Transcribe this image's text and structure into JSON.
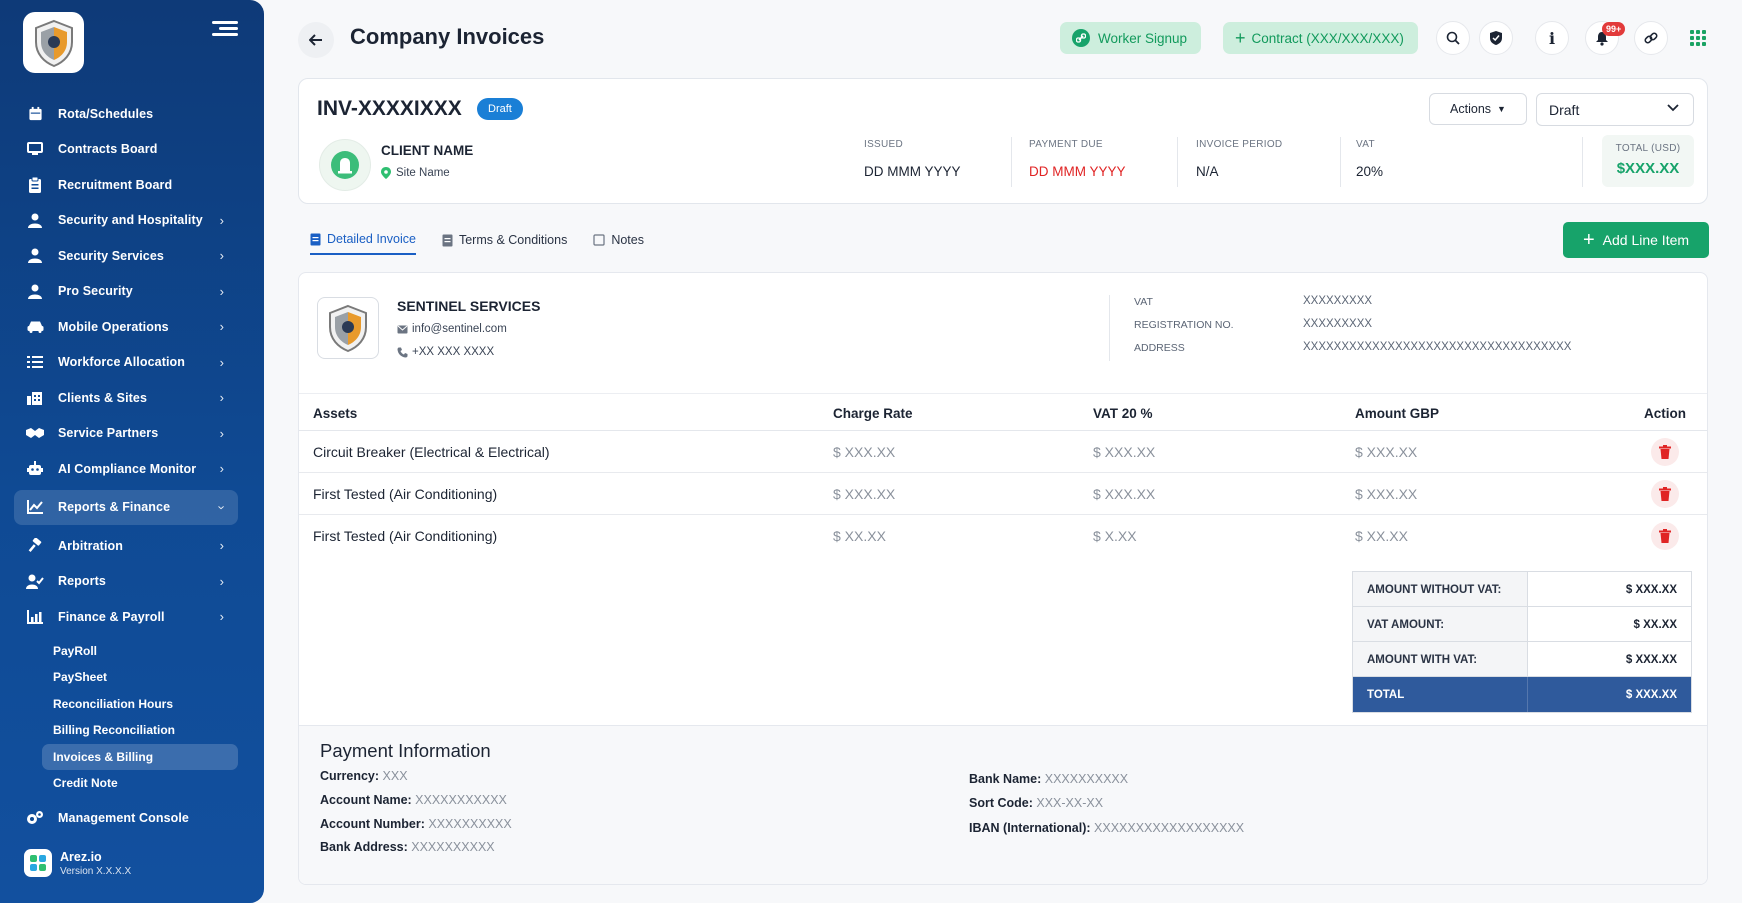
{
  "sidebar": {
    "items": [
      {
        "label": "Rota/Schedules",
        "icon": "calendar-icon",
        "chevron": false
      },
      {
        "label": "Contracts Board",
        "icon": "contracts-icon",
        "chevron": false
      },
      {
        "label": "Recruitment Board",
        "icon": "clipboard-icon",
        "chevron": false
      },
      {
        "label": "Security and Hospitality",
        "icon": "user-icon",
        "chevron": true
      },
      {
        "label": "Security Services",
        "icon": "user-icon",
        "chevron": true
      },
      {
        "label": "Pro Security",
        "icon": "user-icon",
        "chevron": true
      },
      {
        "label": "Mobile Operations",
        "icon": "car-icon",
        "chevron": true
      },
      {
        "label": "Workforce Allocation",
        "icon": "list-icon",
        "chevron": true
      },
      {
        "label": "Clients & Sites",
        "icon": "building-icon",
        "chevron": true
      },
      {
        "label": "Service Partners",
        "icon": "handshake-icon",
        "chevron": true
      },
      {
        "label": "AI Compliance Monitor",
        "icon": "robot-icon",
        "chevron": true
      },
      {
        "label": "Reports & Finance",
        "icon": "chart-icon",
        "chevron": true,
        "expanded": true
      },
      {
        "label": "Arbitration",
        "icon": "gavel-icon",
        "chevron": true
      },
      {
        "label": "Reports",
        "icon": "user-check-icon",
        "chevron": true
      },
      {
        "label": "Finance & Payroll",
        "icon": "chart-icon",
        "chevron": true
      }
    ],
    "subitems": [
      "PayRoll",
      "PaySheet",
      "Reconciliation Hours",
      "Billing Reconciliation",
      "Invoices & Billing",
      "Credit Note"
    ],
    "active_subitem": "Invoices & Billing",
    "management": "Management Console",
    "brand": {
      "name": "Arez.io",
      "version": "Version X.X.X.X"
    }
  },
  "header": {
    "title": "Company Invoices",
    "worker_signup": "Worker Signup",
    "contract": "Contract (XXX/XXX/XXX)",
    "notif_count": "99+"
  },
  "invoice": {
    "number": "INV-XXXXIXXX",
    "badge": "Draft",
    "client_name": "CLIENT NAME",
    "site_name": "Site Name",
    "issued_label": "ISSUED",
    "issued": "DD MMM YYYY",
    "due_label": "PAYMENT DUE",
    "due": "DD MMM YYYY",
    "period_label": "INVOICE PERIOD",
    "period": "N/A",
    "vat_label": "VAT",
    "vat": "20%",
    "total_label": "TOTAL (USD)",
    "total": "$XXX.XX",
    "actions": "Actions",
    "status": "Draft"
  },
  "tabs": [
    "Detailed Invoice",
    "Terms & Conditions",
    "Notes"
  ],
  "add_line": "Add Line Item",
  "company": {
    "name": "SENTINEL SERVICES",
    "email": "info@sentinel.com",
    "phone": "+XX XXX XXXX",
    "vat_label": "VAT",
    "vat": "XXXXXXXXX",
    "reg_label": "REGISTRATION NO.",
    "reg": "XXXXXXXXX",
    "address_label": "ADDRESS",
    "address": "XXXXXXXXXXXXXXXXXXXXXXXXXXXXXXXXXXX"
  },
  "table": {
    "headers": [
      "Assets",
      "Charge Rate",
      "VAT 20 %",
      "Amount GBP",
      "Action"
    ],
    "rows": [
      [
        "Circuit Breaker (Electrical & Electrical)",
        "$ XXX.XX",
        "$ XXX.XX",
        "$ XXX.XX"
      ],
      [
        "First Tested (Air Conditioning)",
        "$ XXX.XX",
        "$ XXX.XX",
        "$ XXX.XX"
      ],
      [
        "First Tested (Air Conditioning)",
        "$ XX.XX",
        "$ X.XX",
        "$ XX.XX"
      ]
    ]
  },
  "totals": [
    [
      "AMOUNT WITHOUT VAT:",
      "$ XXX.XX"
    ],
    [
      "VAT AMOUNT:",
      "$ XX.XX"
    ],
    [
      "AMOUNT WITH VAT:",
      "$ XXX.XX"
    ],
    [
      "TOTAL",
      "$ XXX.XX"
    ]
  ],
  "payment": {
    "title": "Payment Information",
    "left": [
      [
        "Currency:",
        "XXX"
      ],
      [
        "Account Name:",
        "XXXXXXXXXXX"
      ],
      [
        "Account Number:",
        "XXXXXXXXXX"
      ],
      [
        "Bank Address:",
        "XXXXXXXXXX"
      ]
    ],
    "right": [
      [
        "Bank Name:",
        "XXXXXXXXXX"
      ],
      [
        "Sort Code:",
        "XXX-XX-XX"
      ],
      [
        "IBAN (International):",
        "XXXXXXXXXXXXXXXXXX"
      ]
    ]
  },
  "colors": {
    "sidebar": "#0f4a94",
    "accent": "#17a36a",
    "link": "#1a5fc4",
    "danger": "#e02424",
    "total_bg": "#2f5a9c"
  }
}
